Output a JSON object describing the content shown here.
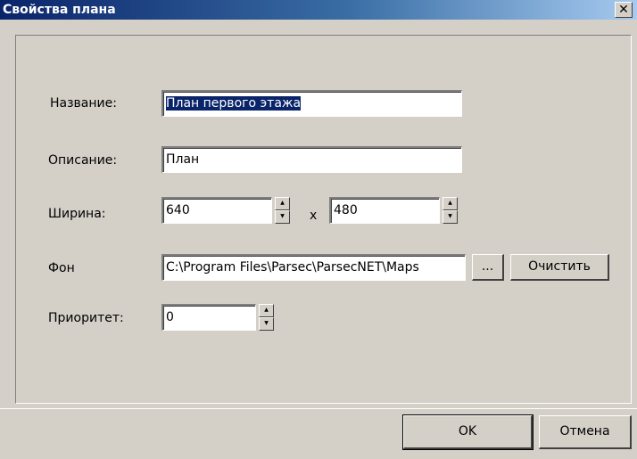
{
  "window": {
    "title": "Свойства плана",
    "close_glyph": "✕"
  },
  "form": {
    "name_label": "Название:",
    "name_value": "План первого этажа",
    "description_label": "Описание:",
    "description_value": "План",
    "width_label": "Ширина:",
    "width_value": "640",
    "times_glyph": "x",
    "height_value": "480",
    "background_label": "Фон",
    "background_value": "C:\\Program Files\\Parsec\\ParsecNET\\Maps",
    "browse_label": "...",
    "clear_label": "Очистить",
    "priority_label": "Приоритет:",
    "priority_value": "0"
  },
  "footer": {
    "ok_label": "OK",
    "cancel_label": "Отмена"
  },
  "icons": {
    "spin_up": "spin-up-icon",
    "spin_down": "spin-down-icon",
    "close": "close-icon"
  },
  "colors": {
    "titlebar_start": "#0a246a",
    "titlebar_end": "#a6caf0",
    "dialog_bg": "#d4d0c8",
    "selection": "#0a246a"
  }
}
